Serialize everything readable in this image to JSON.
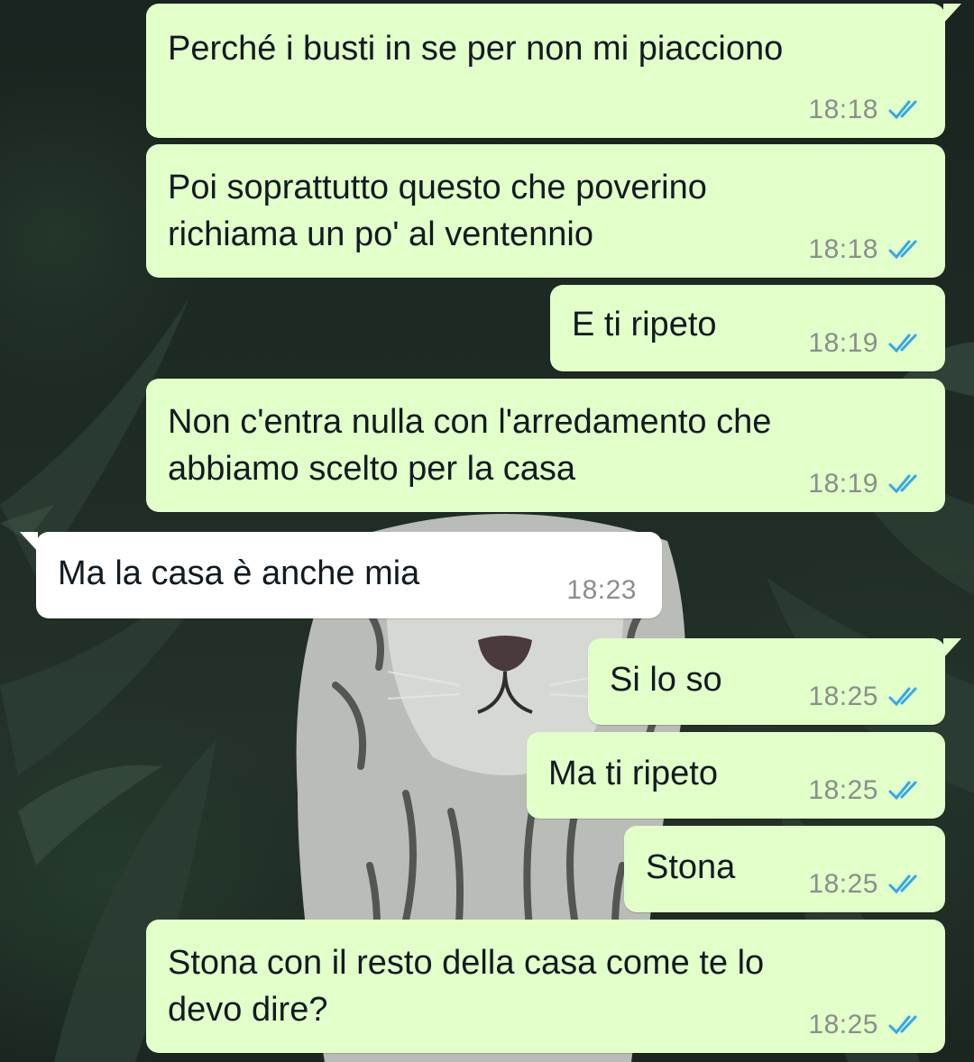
{
  "colors": {
    "outgoing_bubble": "#e2fec9",
    "incoming_bubble": "#ffffff",
    "read_ticks": "#35a7e8",
    "timestamp": "#8a8f8c",
    "text": "#111b21"
  },
  "status_icon": "double-check-read-icon",
  "messages": [
    {
      "direction": "outgoing",
      "text": "Perché i busti in se per non mi piacciono",
      "time": "18:18",
      "status": "read"
    },
    {
      "direction": "outgoing",
      "text": "Poi soprattutto questo che poverino\nrichiama un po' al ventennio",
      "time": "18:18",
      "status": "read"
    },
    {
      "direction": "outgoing",
      "text": "E ti ripeto",
      "time": "18:19",
      "status": "read"
    },
    {
      "direction": "outgoing",
      "text": "Non c'entra nulla con l'arredamento che\nabbiamo scelto per la casa",
      "time": "18:19",
      "status": "read"
    },
    {
      "direction": "incoming",
      "text": "Ma la casa è anche mia",
      "time": "18:23"
    },
    {
      "direction": "outgoing",
      "text": "Si lo so",
      "time": "18:25",
      "status": "read"
    },
    {
      "direction": "outgoing",
      "text": "Ma ti ripeto",
      "time": "18:25",
      "status": "read"
    },
    {
      "direction": "outgoing",
      "text": "Stona",
      "time": "18:25",
      "status": "read"
    },
    {
      "direction": "outgoing",
      "text": "Stona con il resto della casa come te lo\ndevo dire?",
      "time": "18:25",
      "status": "read"
    }
  ]
}
